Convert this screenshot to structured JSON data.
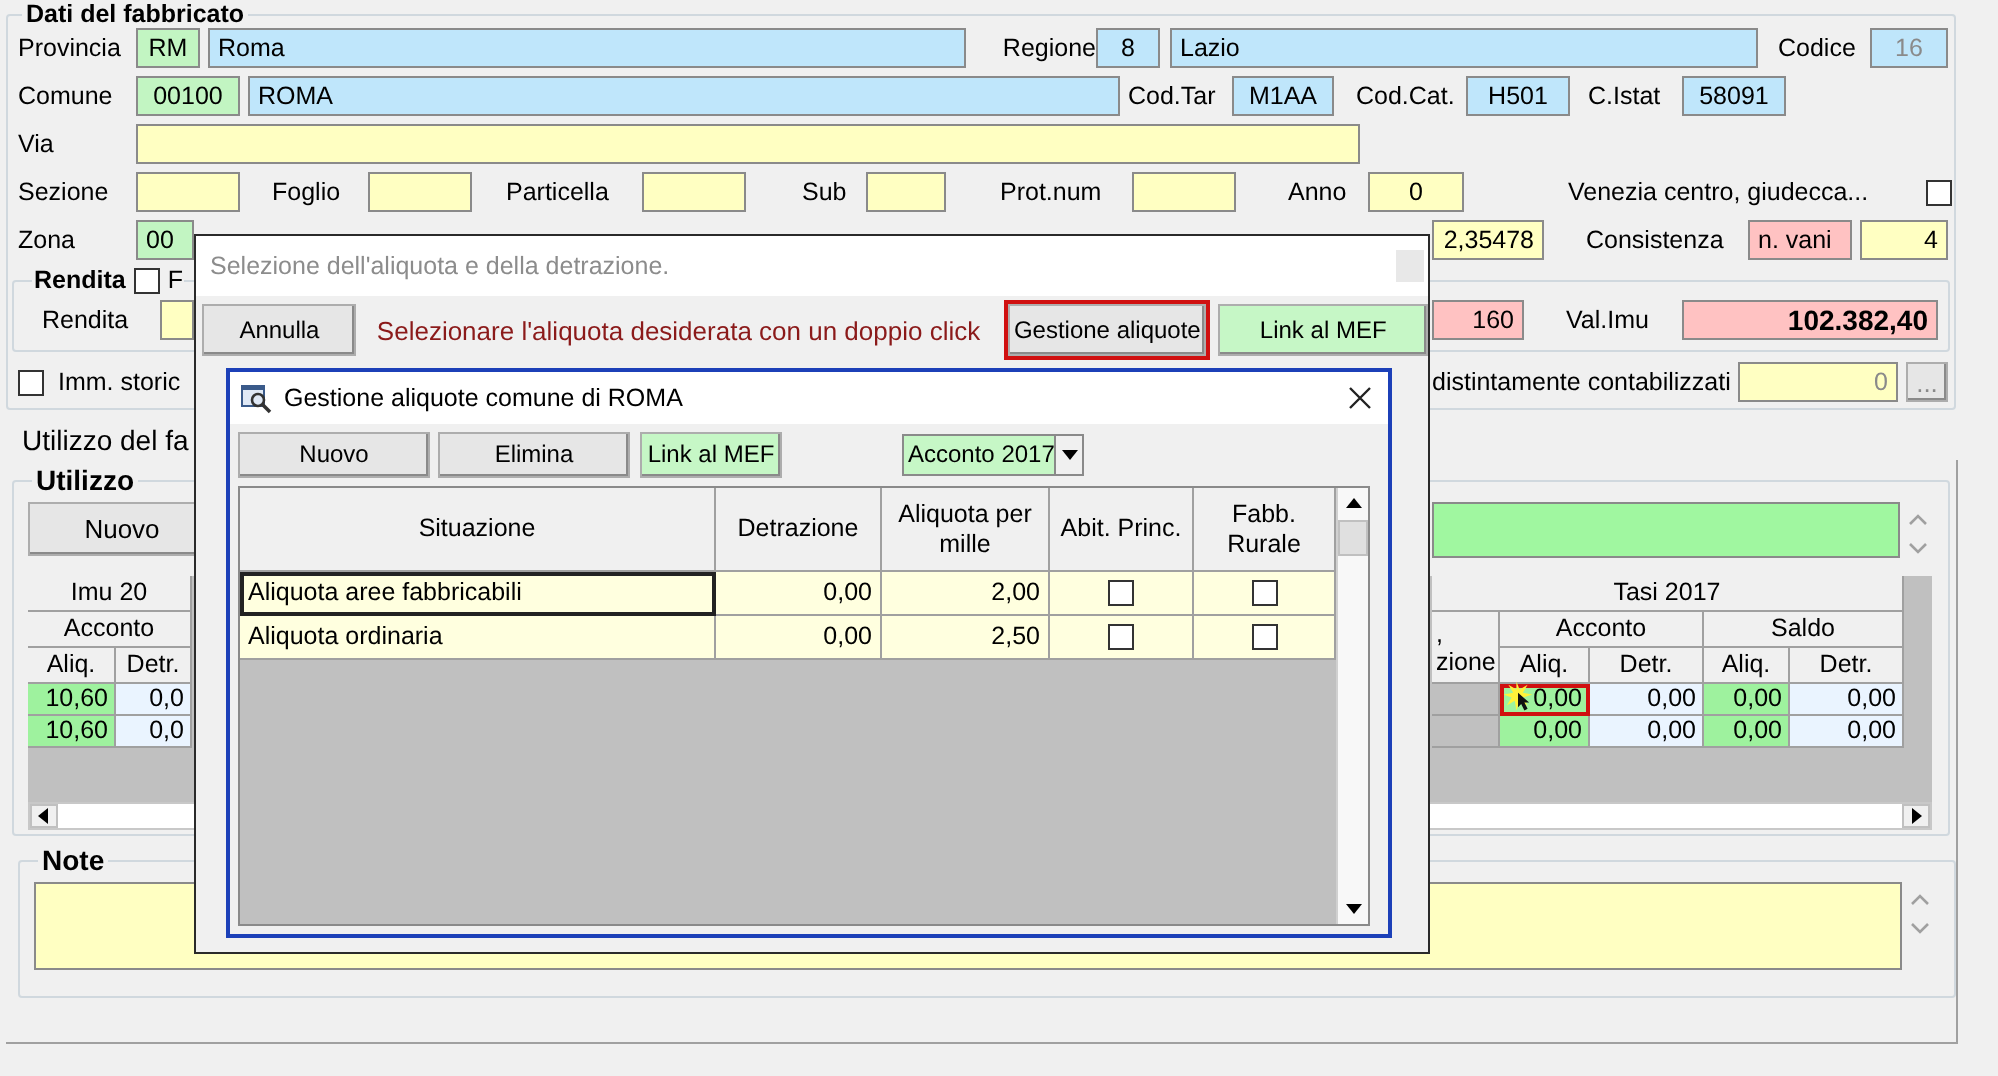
{
  "form": {
    "title": "Dati del fabbricato",
    "provincia": {
      "label": "Provincia",
      "code": "RM",
      "name": "Roma"
    },
    "regione": {
      "label": "Regione",
      "code": "8",
      "name": "Lazio"
    },
    "codice": {
      "label": "Codice",
      "value": "16"
    },
    "comune": {
      "label": "Comune",
      "code": "00100",
      "name": "ROMA"
    },
    "cod_tar": {
      "label": "Cod.Tar",
      "value": "M1AA"
    },
    "cod_cat": {
      "label": "Cod.Cat.",
      "value": "H501"
    },
    "c_istat": {
      "label": "C.Istat",
      "value": "58091"
    },
    "via": {
      "label": "Via"
    },
    "sezione": {
      "label": "Sezione"
    },
    "foglio": {
      "label": "Foglio"
    },
    "particella": {
      "label": "Particella"
    },
    "sub": {
      "label": "Sub"
    },
    "prot_num": {
      "label": "Prot.num"
    },
    "anno": {
      "label": "Anno",
      "value": "0"
    },
    "venezia": {
      "label": "Venezia centro, giudecca...",
      "checked": false
    },
    "zona": {
      "label": "Zona",
      "value": "00"
    },
    "zona_value_2": {
      "value": "2,35478"
    },
    "consistenza": {
      "label": "Consistenza",
      "unit": "n. vani",
      "value": "4"
    },
    "rendita_group": {
      "title": "Rendita",
      "checked": false,
      "checkbox_label": "F",
      "label": "Rendita",
      "value_2": "160"
    },
    "val_imu": {
      "label": "Val.Imu",
      "value": "102.382,40"
    },
    "imm_storico": {
      "label": "Imm. storic",
      "checked": false
    },
    "contabilizzati": {
      "label": "distintamente contabilizzati",
      "value": "0",
      "button": "..."
    }
  },
  "usage": {
    "tab": "Utilizzo del fa",
    "group": "Utilizzo",
    "new_button": "Nuovo",
    "left": {
      "title": "Imu 20",
      "group": "Acconto",
      "columns": [
        "Aliq.",
        "Detr."
      ],
      "rows": [
        [
          "10,60",
          "0,0"
        ],
        [
          "10,60",
          "0,0"
        ]
      ]
    },
    "right": {
      "partial_header": [
        ",",
        "zione"
      ],
      "title": "Tasi 2017",
      "groups": [
        "Acconto",
        "Saldo"
      ],
      "columns": [
        "Aliq.",
        "Detr.",
        "Aliq.",
        "Detr."
      ],
      "rows": [
        {
          "cells": [
            "0,00",
            "0,00",
            "0,00",
            "0,00"
          ],
          "selected": true
        },
        {
          "cells": [
            "0,00",
            "0,00",
            "0,00",
            "0,00"
          ],
          "selected": false
        }
      ]
    }
  },
  "note": {
    "title": "Note"
  },
  "dialog": {
    "title": "Selezione dell'aliquota e della detrazione.",
    "cancel_button": "Annulla",
    "message": "Selezionare l'aliquota desiderata con un doppio click",
    "manage_button": "Gestione aliquote",
    "mef_button": "Link al MEF",
    "manager": {
      "title": "Gestione aliquote comune di ROMA",
      "new_button": "Nuovo",
      "delete_button": "Elimina",
      "mef_button": "Link al MEF",
      "period": "Acconto 2017",
      "columns": [
        "Situazione",
        "Detrazione",
        "Aliquota per mille",
        "Abit. Princ.",
        "Fabb. Rurale"
      ],
      "rows": [
        {
          "situazione": "Aliquota aree fabbricabili",
          "detrazione": "0,00",
          "aliquota": "2,00",
          "abit_princ": false,
          "fabb_rurale": false,
          "selected": true
        },
        {
          "situazione": "Aliquota ordinaria",
          "detrazione": "0,00",
          "aliquota": "2,50",
          "abit_princ": false,
          "fabb_rurale": false,
          "selected": false
        }
      ]
    }
  }
}
